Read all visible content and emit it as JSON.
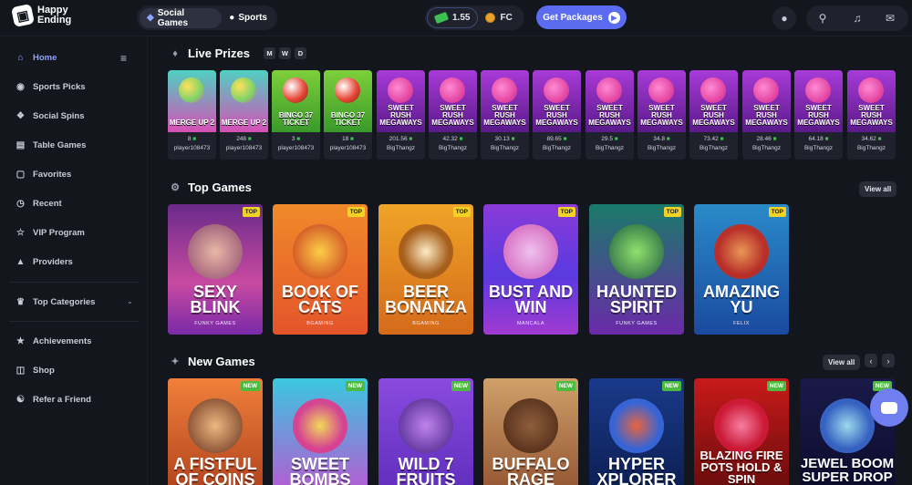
{
  "app": {
    "logo_line1": "Happy",
    "logo_line2": "Ending"
  },
  "topnav": {
    "tabs": [
      {
        "label": "Social Games",
        "icon": "dice-icon"
      },
      {
        "label": "Sports",
        "icon": "ball-icon"
      }
    ],
    "balance_gc": "1.55",
    "balance_fc": "FC",
    "get_packages": "Get Packages"
  },
  "sidebar": {
    "items": [
      {
        "label": "Home",
        "icon": "home-icon"
      },
      {
        "label": "Sports Picks",
        "icon": "football-icon"
      },
      {
        "label": "Social Spins",
        "icon": "spins-icon"
      },
      {
        "label": "Table Games",
        "icon": "table-icon"
      },
      {
        "label": "Favorites",
        "icon": "heart-icon"
      },
      {
        "label": "Recent",
        "icon": "clock-icon"
      },
      {
        "label": "VIP Program",
        "icon": "trophy-icon"
      },
      {
        "label": "Providers",
        "icon": "providers-icon"
      },
      {
        "label": "Top Categories",
        "icon": "crown-icon"
      },
      {
        "label": "Achievements",
        "icon": "achievements-icon"
      },
      {
        "label": "Shop",
        "icon": "cart-icon"
      },
      {
        "label": "Refer a Friend",
        "icon": "users-icon"
      }
    ]
  },
  "live_prizes": {
    "title": "Live Prizes",
    "filters": [
      "M",
      "W",
      "D"
    ],
    "items": [
      {
        "game": "MERGE UP 2",
        "amount": "8",
        "user": "player108473"
      },
      {
        "game": "MERGE UP 2",
        "amount": "248",
        "user": "player108473"
      },
      {
        "game": "BINGO 37 TICKET",
        "amount": "3",
        "user": "player108473"
      },
      {
        "game": "BINGO 37 TICKET",
        "amount": "18",
        "user": "player108473"
      },
      {
        "game": "SWEET RUSH MEGAWAYS",
        "amount": "201.56",
        "user": "BigThangz"
      },
      {
        "game": "SWEET RUSH MEGAWAYS",
        "amount": "42.32",
        "user": "BigThangz"
      },
      {
        "game": "SWEET RUSH MEGAWAYS",
        "amount": "30.13",
        "user": "BigThangz"
      },
      {
        "game": "SWEET RUSH MEGAWAYS",
        "amount": "89.65",
        "user": "BigThangz"
      },
      {
        "game": "SWEET RUSH MEGAWAYS",
        "amount": "29.5",
        "user": "BigThangz"
      },
      {
        "game": "SWEET RUSH MEGAWAYS",
        "amount": "34.8",
        "user": "BigThangz"
      },
      {
        "game": "SWEET RUSH MEGAWAYS",
        "amount": "73.42",
        "user": "BigThangz"
      },
      {
        "game": "SWEET RUSH MEGAWAYS",
        "amount": "28.46",
        "user": "BigThangz"
      },
      {
        "game": "SWEET RUSH MEGAWAYS",
        "amount": "64.18",
        "user": "BigThangz"
      },
      {
        "game": "SWEET RUSH MEGAWAYS",
        "amount": "34.62",
        "user": "BigThangz"
      }
    ]
  },
  "top_games": {
    "title": "Top Games",
    "view_all": "View all",
    "badge": "TOP",
    "items": [
      {
        "title": "SEXY BLINK",
        "provider": "FUNKY GAMES"
      },
      {
        "title": "BOOK OF CATS",
        "provider": "BGAMING"
      },
      {
        "title": "BEER BONANZA",
        "provider": "BGAMING"
      },
      {
        "title": "BUST AND WIN",
        "provider": "MANCALA"
      },
      {
        "title": "HAUNTED SPIRIT",
        "provider": "FUNKY GAMES"
      },
      {
        "title": "AMAZING YU",
        "provider": "FELIX"
      }
    ]
  },
  "new_games": {
    "title": "New Games",
    "view_all": "View all",
    "prev": "‹",
    "next": "›",
    "badge": "NEW",
    "items": [
      {
        "title": "A FISTFUL OF COINS"
      },
      {
        "title": "SWEET BOMBS"
      },
      {
        "title": "WILD 7 FRUITS"
      },
      {
        "title": "BUFFALO RAGE"
      },
      {
        "title": "HYPER XPLORER"
      },
      {
        "title": "BLAZING FIRE POTS HOLD & SPIN"
      },
      {
        "title": "JEWEL BOOM SUPER DROP"
      }
    ]
  }
}
